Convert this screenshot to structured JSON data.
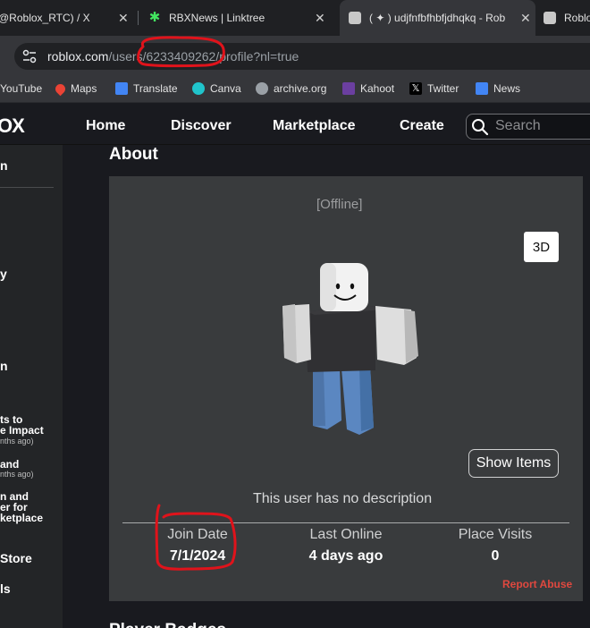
{
  "browser": {
    "tabs": [
      {
        "title": "@Roblox_RTC) / X"
      },
      {
        "title": "RBXNews | Linktree"
      },
      {
        "title": "( ✦ ) udjfnfbfhbfjdhqkq - Rob"
      },
      {
        "title": "Roblo"
      }
    ],
    "url": {
      "domain": "roblox.com",
      "path": "/users/6233409262/profile?nl=true"
    },
    "bookmarks": [
      {
        "label": "YouTube"
      },
      {
        "label": "Maps"
      },
      {
        "label": "Translate"
      },
      {
        "label": "Canva"
      },
      {
        "label": "archive.org"
      },
      {
        "label": "Kahoot"
      },
      {
        "label": "Twitter"
      },
      {
        "label": "News"
      }
    ]
  },
  "nav": {
    "logo": "OX",
    "links": [
      "Home",
      "Discover",
      "Marketplace",
      "Create"
    ],
    "search_placeholder": "Search"
  },
  "sidebar": {
    "items": [
      {
        "text": "n"
      },
      {
        "text": "y"
      },
      {
        "text": "n"
      },
      {
        "text": "ts to\ne Impact",
        "sub": "nths ago)"
      },
      {
        "text": "and",
        "sub": "nths ago)"
      },
      {
        "text": "n and\ner for\nketplace"
      },
      {
        "text": "Store"
      },
      {
        "text": "ls"
      }
    ]
  },
  "profile": {
    "section_title": "About",
    "presence": "[Offline]",
    "btn_3d": "3D",
    "show_items": "Show Items",
    "description": "This user has no description",
    "stats": [
      {
        "label": "Join Date",
        "value": "7/1/2024"
      },
      {
        "label": "Last Online",
        "value": "4 days ago"
      },
      {
        "label": "Place Visits",
        "value": "0"
      }
    ],
    "report": "Report Abuse",
    "next_section": "Player Badges"
  },
  "colors": {
    "accent_red": "#e0483f",
    "annotation_red": "#e0131b",
    "card_bg": "#393b3d",
    "page_bg": "#191a1f"
  }
}
